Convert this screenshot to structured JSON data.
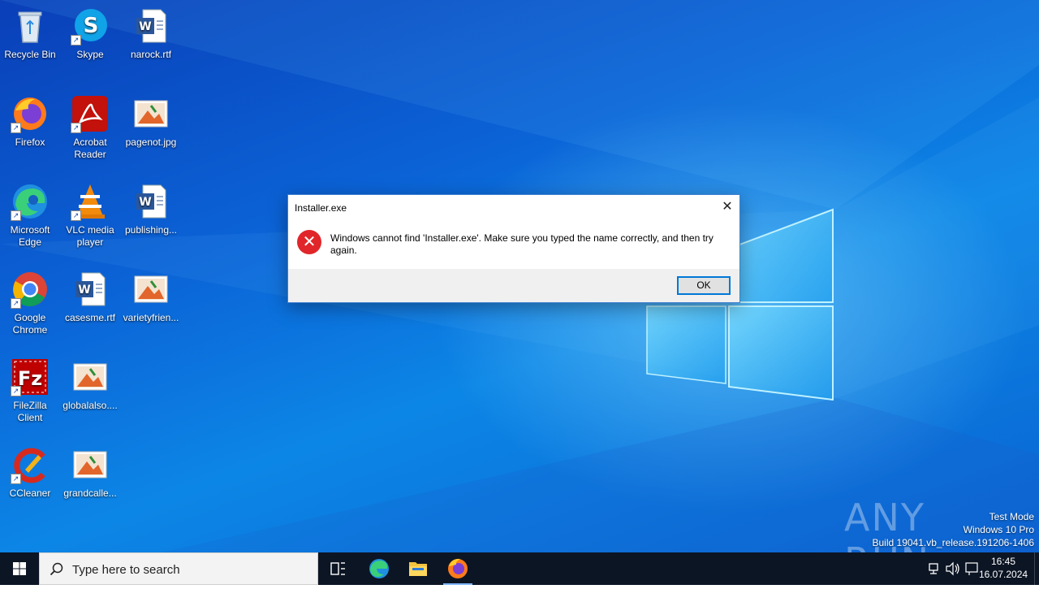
{
  "desktop": {
    "icons": [
      {
        "label": "Recycle Bin",
        "icon": "recycle-bin-icon"
      },
      {
        "label": "Skype",
        "icon": "skype-icon"
      },
      {
        "label": "narock.rtf",
        "icon": "word-document-icon"
      },
      {
        "label": "Firefox",
        "icon": "firefox-icon"
      },
      {
        "label": "Acrobat Reader",
        "icon": "acrobat-reader-icon"
      },
      {
        "label": "pagenot.jpg",
        "icon": "image-file-icon"
      },
      {
        "label": "Microsoft Edge",
        "icon": "edge-icon"
      },
      {
        "label": "VLC media player",
        "icon": "vlc-icon"
      },
      {
        "label": "publishing...",
        "icon": "word-document-icon"
      },
      {
        "label": "Google Chrome",
        "icon": "chrome-icon"
      },
      {
        "label": "casesme.rtf",
        "icon": "word-document-icon"
      },
      {
        "label": "varietyfrien...",
        "icon": "image-file-icon"
      },
      {
        "label": "FileZilla Client",
        "icon": "filezilla-icon"
      },
      {
        "label": "globalalso....",
        "icon": "image-file-icon"
      },
      {
        "label": "CCleaner",
        "icon": "ccleaner-icon"
      },
      {
        "label": "grandcalle...",
        "icon": "image-file-icon"
      }
    ]
  },
  "dialog": {
    "title": "Installer.exe",
    "message": "Windows cannot find 'Installer.exe'. Make sure you typed the name correctly, and then try again.",
    "ok_label": "OK",
    "close_glyph": "✕",
    "error_glyph": "✕"
  },
  "watermark": {
    "brand": "ANY RUN",
    "line1": "Test Mode",
    "line2": "Windows 10 Pro",
    "line3": "Build 19041.vb_release.191206-1406"
  },
  "taskbar": {
    "search_placeholder": "Type here to search",
    "time": "16:45",
    "date": "16.07.2024"
  },
  "colors": {
    "taskbar": "#0c1524",
    "error_red": "#e0262a",
    "accent": "#0078d7"
  }
}
